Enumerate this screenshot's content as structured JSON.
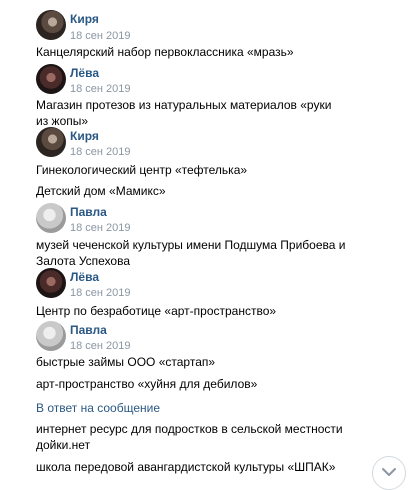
{
  "messages": [
    {
      "author": "Киря",
      "date": "18 сен 2019",
      "avatar": "kirya",
      "text": "Канцелярский набор первоклассника «мразь»"
    },
    {
      "author": "Лёва",
      "date": "18 сен 2019",
      "avatar": "leva",
      "text": "Магазин протезов из натуральных материалов «руки из жопы»"
    },
    {
      "author": "Киря",
      "date": "18 сен 2019",
      "avatar": "kirya",
      "text": "Гинекологический центр «тефтелька»",
      "text2": "Детский дом «Мамикс»"
    },
    {
      "author": "Павла",
      "date": "18 сен 2019",
      "avatar": "pavla",
      "text": "музей чеченской культуры имени Подшума Прибоева и Залота Успехова"
    },
    {
      "author": "Лёва",
      "date": "18 сен 2019",
      "avatar": "leva",
      "text": "Центр по безработице «арт-пространство»"
    },
    {
      "author": "Павла",
      "date": "18 сен 2019",
      "avatar": "pavla",
      "text": "быстрые займы ООО «стартап»",
      "text2": "арт-пространство «хуйня для дебилов»",
      "reply": "В ответ на сообщение",
      "text3": "интернет ресурс для подростков в сельской местности дойки.нет",
      "text4": "школа передовой авангардистской культуры «ШПАК»"
    }
  ],
  "icons": {
    "scroll_down": "chevron-down-icon"
  }
}
